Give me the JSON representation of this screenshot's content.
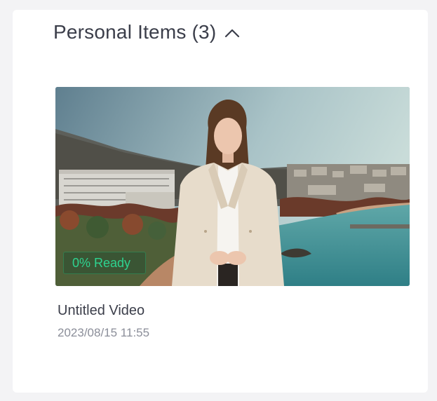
{
  "section": {
    "title": "Personal Items (3)",
    "chevron_icon": "chevron-up-icon"
  },
  "video": {
    "status": "0% Ready",
    "title": "Untitled Video",
    "date": "2023/08/15 11:55",
    "thumbnail_icon": "presenter-coastal-scene-image"
  },
  "colors": {
    "title_text": "#3b3e4a",
    "meta_text": "#8b8e99",
    "status_text": "#2ed390"
  }
}
